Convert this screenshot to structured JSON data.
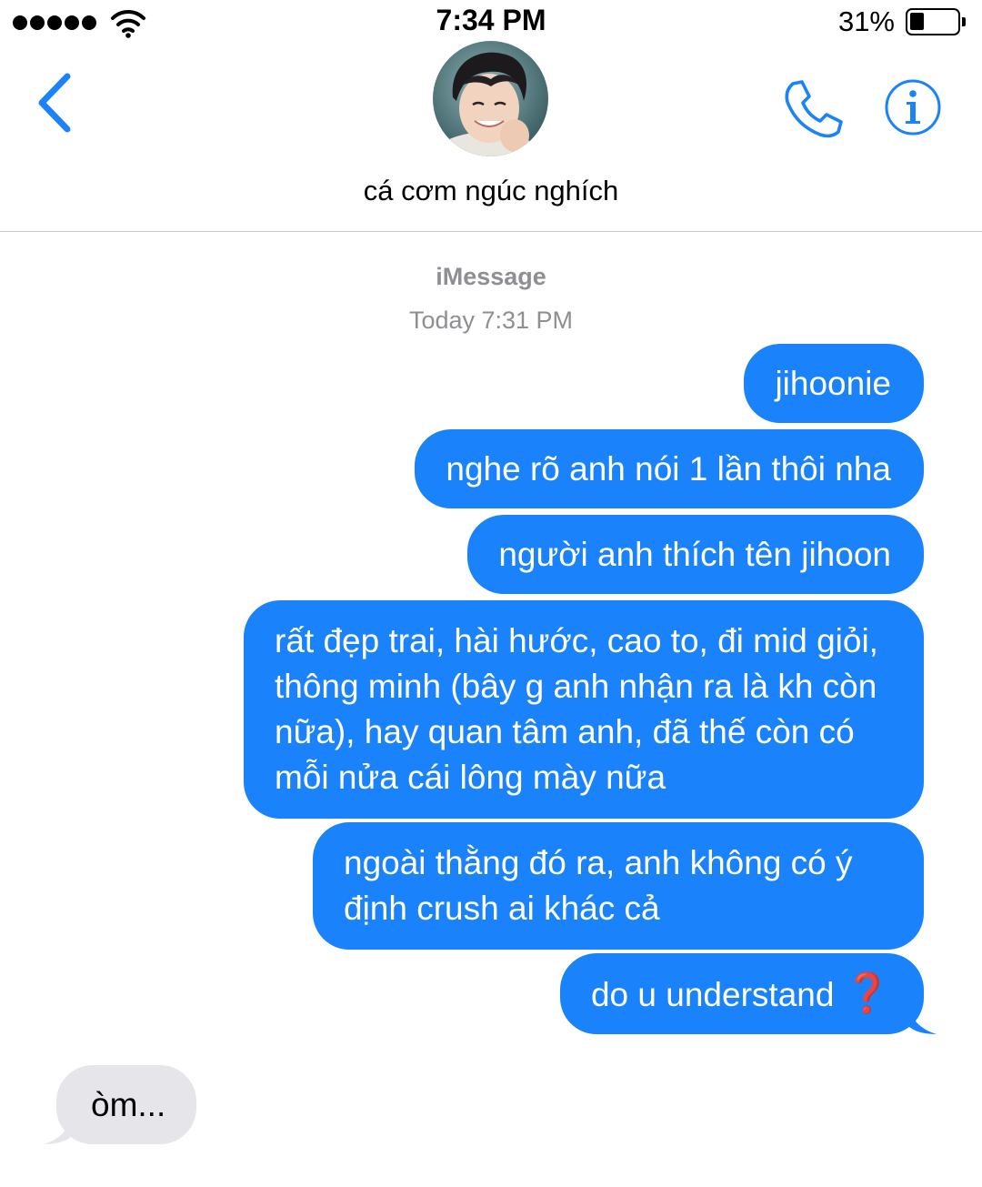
{
  "status_bar": {
    "time": "7:34 PM",
    "battery": "31%"
  },
  "header": {
    "contact_name": "cá cơm ngúc nghích"
  },
  "conversation": {
    "service": "iMessage",
    "timestamp": "Today 7:31 PM",
    "messages": [
      {
        "from": "me",
        "text": "jihoonie"
      },
      {
        "from": "me",
        "text": "nghe rõ anh nói 1 lần thôi nha"
      },
      {
        "from": "me",
        "text": "người anh thích tên jihoon"
      },
      {
        "from": "me",
        "text": "rất đẹp trai, hài hước, cao to, đi mid giỏi, thông minh (bây g anh nhận ra là kh còn nữa), hay quan tâm anh, đã thế còn có mỗi nửa cái lông mày nữa"
      },
      {
        "from": "me",
        "text": "ngoài thằng đó ra, anh không có ý định crush ai khác cả"
      },
      {
        "from": "me",
        "text": "do u understand",
        "emoji": "❓"
      },
      {
        "from": "contact",
        "text": "òm..."
      }
    ]
  },
  "colors": {
    "accent": "#1a82fb",
    "sent_bubble": "#1a82fb",
    "received_bubble": "#e5e5ea",
    "meta_text": "#8e8e93"
  },
  "icons": [
    "signal-icon",
    "wifi-icon",
    "battery-icon",
    "back-chevron-icon",
    "phone-icon",
    "info-icon"
  ]
}
